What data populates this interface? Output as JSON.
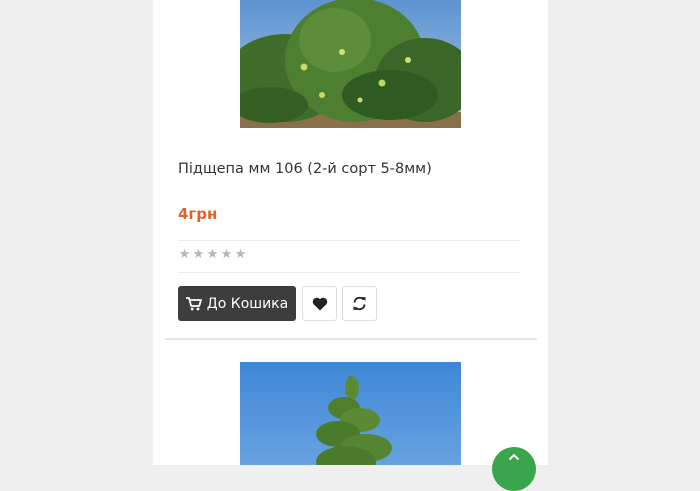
{
  "product": {
    "title": "Підщепа мм 106 (2-й сорт 5-8мм)",
    "price": "4грн",
    "rating": 0,
    "rating_max": 5,
    "add_to_cart_label": "До Кошика"
  },
  "icons": {
    "cart": "shopping-cart-icon",
    "wishlist": "heart-icon",
    "compare": "refresh-icon",
    "scroll_top": "chevron-up-icon"
  },
  "colors": {
    "price": "#e0622a",
    "cart_button": "#3d3d3d",
    "scroll_top_button": "#3aa64c",
    "star_empty": "#b5b5b5"
  }
}
